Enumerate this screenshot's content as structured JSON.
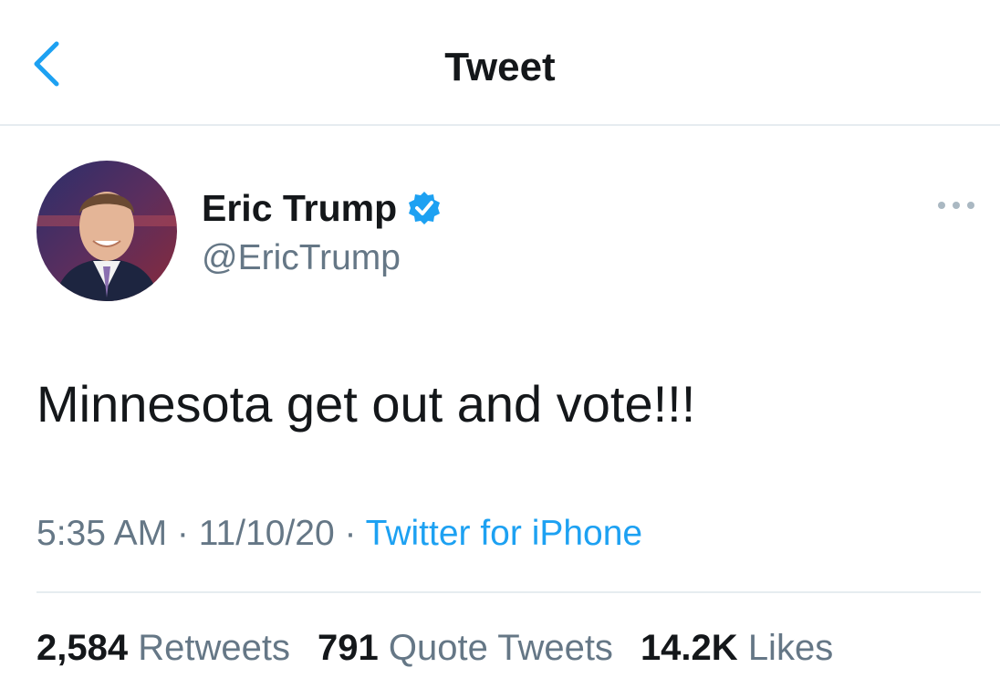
{
  "header": {
    "title": "Tweet",
    "back_icon": "chevron-left-icon"
  },
  "tweet": {
    "author": {
      "display_name": "Eric Trump",
      "handle": "@EricTrump",
      "verified": true
    },
    "text": "Minnesota get out and vote!!!",
    "time": "5:35 AM",
    "date": "11/10/20",
    "separator": " · ",
    "source": "Twitter for iPhone",
    "stats": {
      "retweets": {
        "count": "2,584",
        "label": "Retweets"
      },
      "quotes": {
        "count": "791",
        "label": "Quote Tweets"
      },
      "likes": {
        "count": "14.2K",
        "label": "Likes"
      }
    }
  },
  "colors": {
    "accent": "#1da1f2",
    "text_primary": "#14171a",
    "text_secondary": "#657786",
    "divider": "#e6ecf0"
  }
}
